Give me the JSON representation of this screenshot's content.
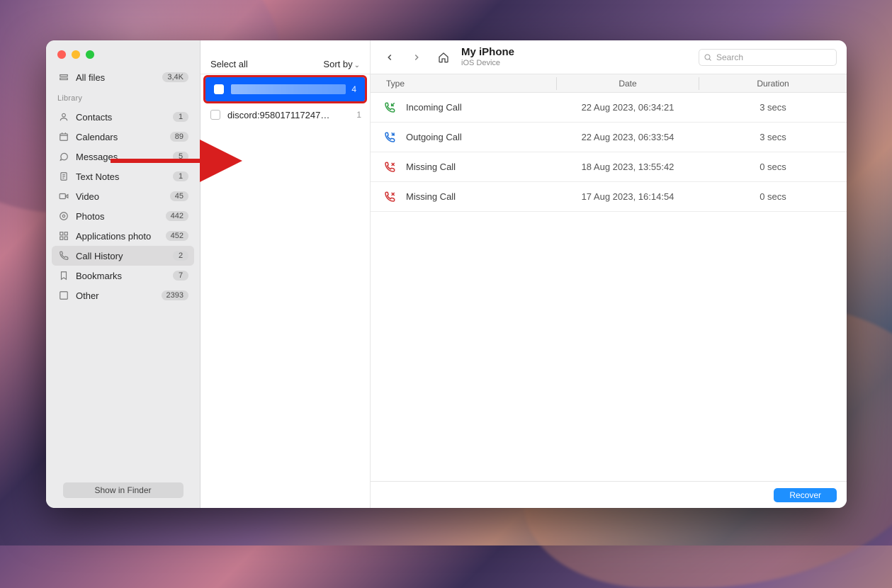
{
  "header": {
    "title": "My iPhone",
    "subtitle": "iOS Device",
    "search_placeholder": "Search"
  },
  "sidebar": {
    "all_files": {
      "label": "All files",
      "badge": "3,4K"
    },
    "library_header": "Library",
    "items": [
      {
        "label": "Contacts",
        "badge": "1"
      },
      {
        "label": "Calendars",
        "badge": "89"
      },
      {
        "label": "Messages",
        "badge": "5"
      },
      {
        "label": "Text Notes",
        "badge": "1"
      },
      {
        "label": "Video",
        "badge": "45"
      },
      {
        "label": "Photos",
        "badge": "442"
      },
      {
        "label": "Applications photo",
        "badge": "452"
      },
      {
        "label": "Call History",
        "badge": "2",
        "active": true
      },
      {
        "label": "Bookmarks",
        "badge": "7"
      },
      {
        "label": "Other",
        "badge": "2393"
      }
    ],
    "finder_button": "Show in Finder"
  },
  "middle": {
    "select_all": "Select all",
    "sort_by": "Sort by",
    "contacts": [
      {
        "redacted": true,
        "count": "4",
        "selected": true
      },
      {
        "label": "discord:958017117247…",
        "count": "1"
      }
    ]
  },
  "table": {
    "columns": {
      "type": "Type",
      "date": "Date",
      "duration": "Duration"
    },
    "rows": [
      {
        "kind": "incoming",
        "type": "Incoming Call",
        "date": "22 Aug 2023, 06:34:21",
        "duration": "3 secs"
      },
      {
        "kind": "outgoing",
        "type": "Outgoing Call",
        "date": "22 Aug 2023, 06:33:54",
        "duration": "3 secs"
      },
      {
        "kind": "missed",
        "type": "Missing Call",
        "date": "18 Aug 2023, 13:55:42",
        "duration": "0 secs"
      },
      {
        "kind": "missed",
        "type": "Missing Call",
        "date": "17 Aug 2023, 16:14:54",
        "duration": "0 secs"
      }
    ]
  },
  "footer": {
    "recover": "Recover"
  }
}
